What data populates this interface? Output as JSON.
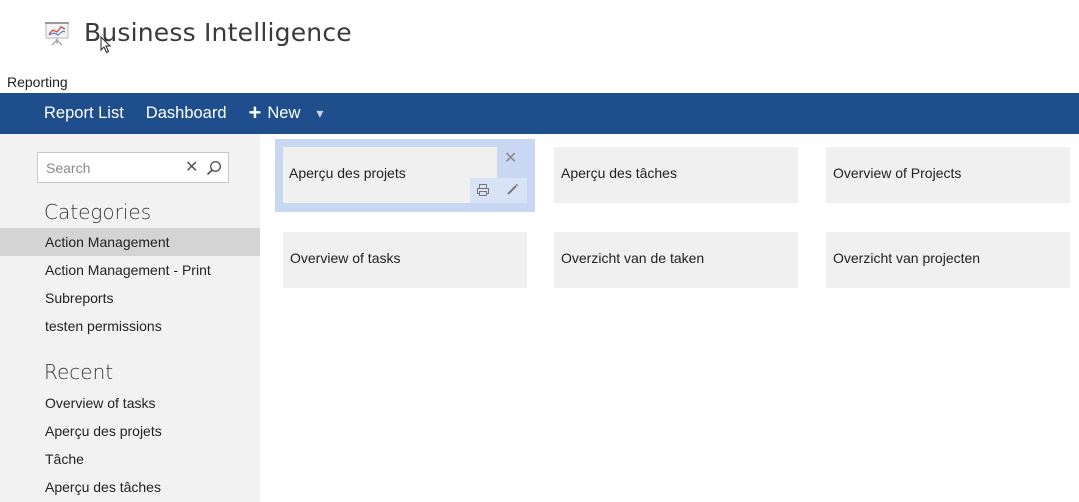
{
  "app": {
    "title": "Business Intelligence",
    "section": "Reporting"
  },
  "navbar": {
    "report_list": "Report List",
    "dashboard": "Dashboard",
    "new_label": "New",
    "plus": "+",
    "caret": "▾",
    "bg_color": "#1e4e8c"
  },
  "search": {
    "placeholder": "Search",
    "value": "",
    "clear": "✕"
  },
  "sidebar": {
    "categories_heading": "Categories",
    "categories": [
      {
        "label": "Action Management",
        "active": true
      },
      {
        "label": "Action Management - Print",
        "active": false
      },
      {
        "label": "Subreports",
        "active": false
      },
      {
        "label": "testen permissions",
        "active": false
      }
    ],
    "recent_heading": "Recent",
    "recent": [
      {
        "label": "Overview of tasks"
      },
      {
        "label": "Aperçu des projets"
      },
      {
        "label": "Tâche"
      },
      {
        "label": "Aperçu des tâches"
      }
    ]
  },
  "reports": {
    "tiles": [
      {
        "label": "Aperçu des projets",
        "selected": true
      },
      {
        "label": "Aperçu des tâches"
      },
      {
        "label": "Overview of Projects"
      },
      {
        "label": "Overview of tasks"
      },
      {
        "label": "Overzicht van de taken"
      },
      {
        "label": "Overzicht van projecten"
      }
    ],
    "close": "✕",
    "icons": [
      "close-icon",
      "print-icon",
      "edit-icon"
    ]
  }
}
